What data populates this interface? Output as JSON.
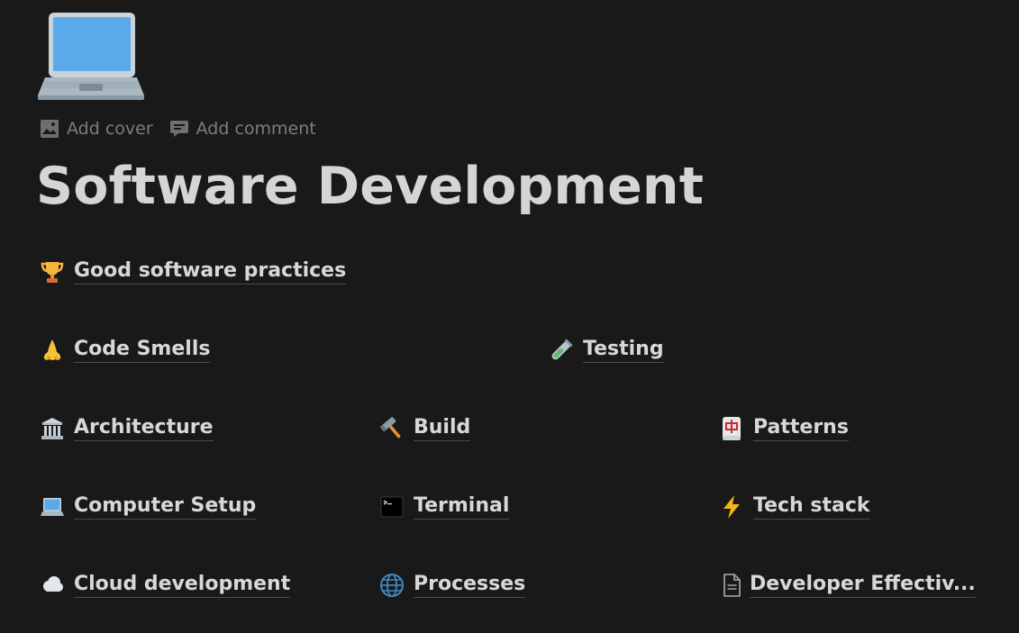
{
  "page": {
    "icon": "laptop-icon",
    "controls": {
      "add_cover": "Add cover",
      "add_comment": "Add comment"
    },
    "title": "Software Development"
  },
  "links": [
    {
      "label": "Good software practices",
      "icon": "trophy-icon"
    },
    {
      "label": "Code Smells",
      "icon": "nose-icon"
    },
    {
      "label": "Testing",
      "icon": "test-tube-icon"
    },
    {
      "label": "Architecture",
      "icon": "classical-building-icon"
    },
    {
      "label": "Build",
      "icon": "hammer-icon"
    },
    {
      "label": "Patterns",
      "icon": "mahjong-tile-icon"
    },
    {
      "label": "Computer Setup",
      "icon": "laptop-icon"
    },
    {
      "label": "Terminal",
      "icon": "terminal-icon"
    },
    {
      "label": "Tech stack",
      "icon": "lightning-icon"
    },
    {
      "label": "Cloud development",
      "icon": "cloud-icon"
    },
    {
      "label": "Processes",
      "icon": "globe-icon"
    },
    {
      "label": "Developer Effectiv...",
      "icon": "page-icon"
    }
  ],
  "colors": {
    "background": "#191919",
    "text": "#d5d5d5",
    "muted": "#7d7d7d"
  }
}
